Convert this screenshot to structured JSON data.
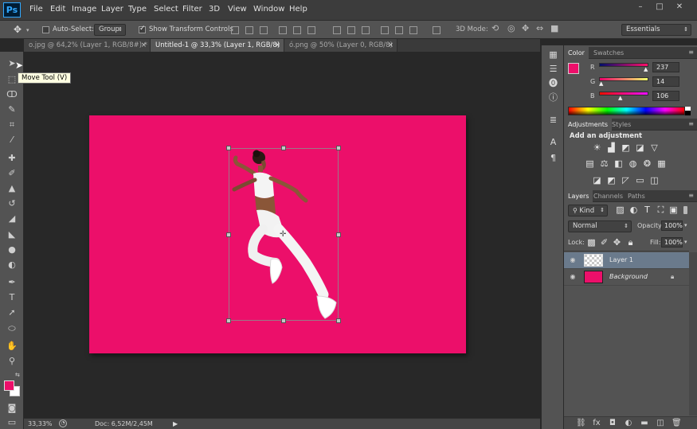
{
  "app": {
    "logo": "Ps",
    "menu": [
      "File",
      "Edit",
      "Image",
      "Layer",
      "Type",
      "Select",
      "Filter",
      "3D",
      "View",
      "Window",
      "Help"
    ],
    "window_buttons": [
      "–",
      "□",
      "✕"
    ]
  },
  "options_bar": {
    "auto_select_label": "Auto-Select:",
    "auto_select_checked": false,
    "auto_select_value": "Group",
    "show_transform_label": "Show Transform Controls",
    "show_transform_checked": true,
    "mode_3d_label": "3D Mode:",
    "workspace": "Essentials"
  },
  "tabs": [
    {
      "label": "o.jpg @ 64,2% (Layer 1, RGB/8#) *",
      "active": false,
      "close": "×"
    },
    {
      "label": "Untitled-1 @ 33,3% (Layer 1, RGB/8) *",
      "active": true,
      "close": "×"
    },
    {
      "label": "ó.png @ 50% (Layer 0, RGB/8)",
      "active": false,
      "close": "×"
    }
  ],
  "toolbar": {
    "tools": [
      "move-icon",
      "marquee-icon",
      "lasso-icon",
      "quick-select-icon",
      "crop-icon",
      "eyedropper-icon",
      "healing-icon",
      "brush-icon",
      "stamp-icon",
      "history-brush-icon",
      "eraser-icon",
      "bucket-icon",
      "blur-icon",
      "dodge-icon",
      "pen-icon",
      "type-icon",
      "path-select-icon",
      "ellipse-icon",
      "hand-icon",
      "zoom-icon"
    ],
    "foreground_color": "#ec0f6a",
    "background_color": "#ffffff"
  },
  "tooltip": "Move Tool (V)",
  "canvas": {
    "background_color": "#ec0f6a"
  },
  "status_bar": {
    "zoom": "33,33%",
    "doc_info": "Doc: 6,52M/2,45M"
  },
  "color_panel": {
    "tabs": [
      "Color",
      "Swatches"
    ],
    "R": {
      "label": "R",
      "value": "237",
      "level": 0.929
    },
    "G": {
      "label": "G",
      "value": "14",
      "level": 0.055
    },
    "B": {
      "label": "B",
      "value": "106",
      "level": 0.416
    },
    "swatch": "#ed0e6a"
  },
  "adjustments_panel": {
    "tabs": [
      "Adjustments",
      "Styles"
    ],
    "heading": "Add an adjustment",
    "icons_row1": [
      "brightness-icon",
      "levels-icon",
      "curves-icon",
      "exposure-icon",
      "vibrance-icon"
    ],
    "icons_row2": [
      "hue-sat-icon",
      "color-balance-icon",
      "bw-icon",
      "photo-filter-icon",
      "channel-mixer-icon",
      "color-lookup-icon"
    ],
    "icons_row3": [
      "invert-icon",
      "posterize-icon",
      "threshold-icon",
      "selective-color-icon",
      "gradient-map-icon"
    ]
  },
  "layers_panel": {
    "tabs": [
      "Layers",
      "Channels",
      "Paths"
    ],
    "filter_kind": "Kind",
    "blend_mode": "Normal",
    "opacity_label": "Opacity:",
    "opacity_value": "100%",
    "lock_label": "Lock:",
    "fill_label": "Fill:",
    "fill_value": "100%",
    "layers": [
      {
        "name": "Layer 1",
        "selected": true,
        "italic": false
      },
      {
        "name": "Background",
        "selected": false,
        "italic": true,
        "locked": true
      }
    ],
    "bottom_icons": [
      "link-icon",
      "fx-icon",
      "mask-icon",
      "adjustment-layer-icon",
      "group-icon",
      "new-layer-icon",
      "trash-icon"
    ]
  }
}
